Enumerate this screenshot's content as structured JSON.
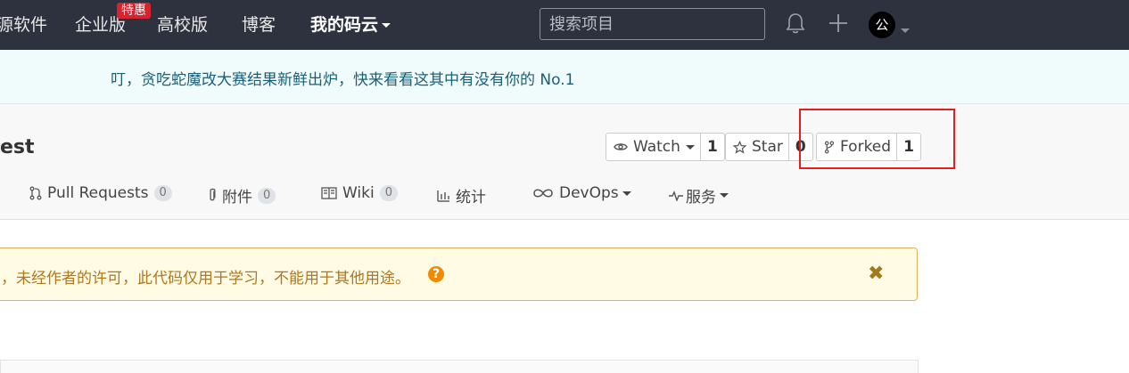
{
  "nav": {
    "items": [
      "源软件",
      "企业版",
      "高校版",
      "博客",
      "我的码云"
    ],
    "badge": "特惠",
    "search_placeholder": "搜索项目",
    "avatar_text": "公"
  },
  "announcement": "叮，贪吃蛇魔改大赛结果新鲜出炉，快来看看这其中有没有你的 No.1",
  "repo": {
    "title": "est",
    "watch": {
      "label": "Watch",
      "count": "1"
    },
    "star": {
      "label": "Star",
      "count": "0"
    },
    "fork": {
      "label": "Forked",
      "count": "1"
    }
  },
  "tabs": [
    {
      "label": "Pull Requests",
      "count": "0"
    },
    {
      "label": "附件",
      "count": "0"
    },
    {
      "label": "Wiki",
      "count": "0"
    },
    {
      "label": "统计"
    },
    {
      "label": "DevOps"
    },
    {
      "label": "服务"
    }
  ],
  "warning": {
    "text": "，未经作者的许可，此代码仅用于学习，不能用于其他用途。",
    "help": "?",
    "close": "✖"
  },
  "colors": {
    "nav_bg": "#2e323e",
    "badge_red": "#d6232f",
    "highlight_red": "#e02020",
    "warning_text": "#b1771b",
    "help_orange": "#f08a00"
  }
}
